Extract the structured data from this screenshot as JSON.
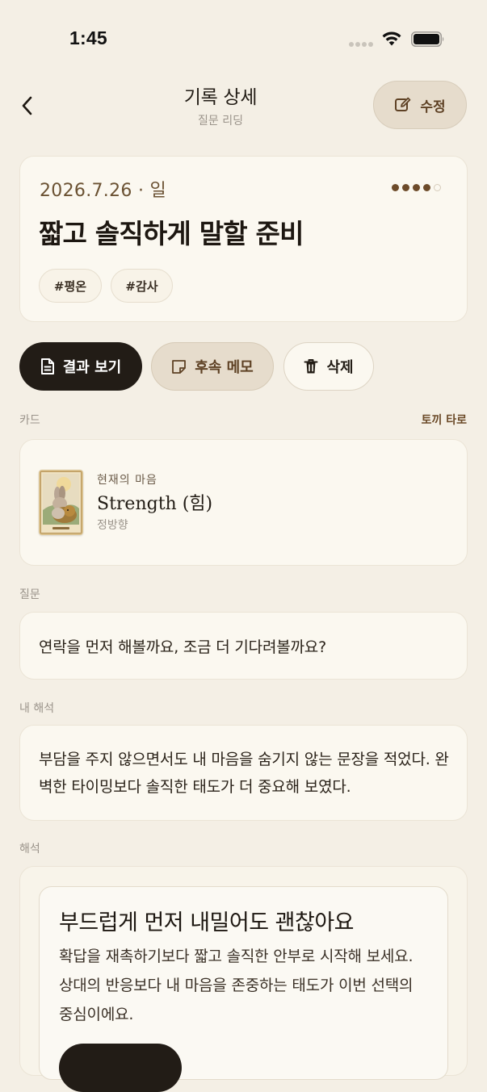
{
  "status_bar": {
    "time": "1:45"
  },
  "header": {
    "title": "기록 상세",
    "subtitle": "질문 리딩",
    "edit_label": "수정"
  },
  "summary": {
    "date": "2026.7.26 · 일",
    "title": "짧고 솔직하게 말할 준비",
    "rating": 4,
    "rating_max": 5,
    "tags": [
      "#평온",
      "#감사"
    ]
  },
  "actions": {
    "result_label": "결과 보기",
    "memo_label": "후속 메모",
    "delete_label": "삭제"
  },
  "cards_section": {
    "label": "카드",
    "deck_link": "토끼 타로",
    "card": {
      "position": "현재의 마음",
      "name": "Strength (힘)",
      "orientation": "정방향",
      "thumb_caption": "Strength XI"
    }
  },
  "question_section": {
    "label": "질문",
    "text": "연락을 먼저 해볼까요, 조금 더 기다려볼까요?"
  },
  "my_interpretation_section": {
    "label": "내 해석",
    "text": "부담을 주지 않으면서도 내 마음을 숨기지 않는 문장을 적었다. 완벽한 타이밍보다 솔직한 태도가 더 중요해 보였다."
  },
  "interpretation_section": {
    "label": "해석",
    "title": "부드럽게 먼저 내밀어도 괜찮아요",
    "body": "확답을 재촉하기보다 짧고 솔직한 안부로 시작해 보세요. 상대의 반응보다 내 마음을 존중하는 태도가 이번 선택의 중심이에요."
  },
  "colors": {
    "background": "#f4efe5",
    "card": "#fbf8f0",
    "accent_brown": "#6b4a28",
    "dark_button": "#221c16"
  },
  "icons": [
    "back-chevron-icon",
    "edit-icon",
    "document-icon",
    "note-icon",
    "trash-icon",
    "wifi-icon",
    "battery-icon"
  ]
}
